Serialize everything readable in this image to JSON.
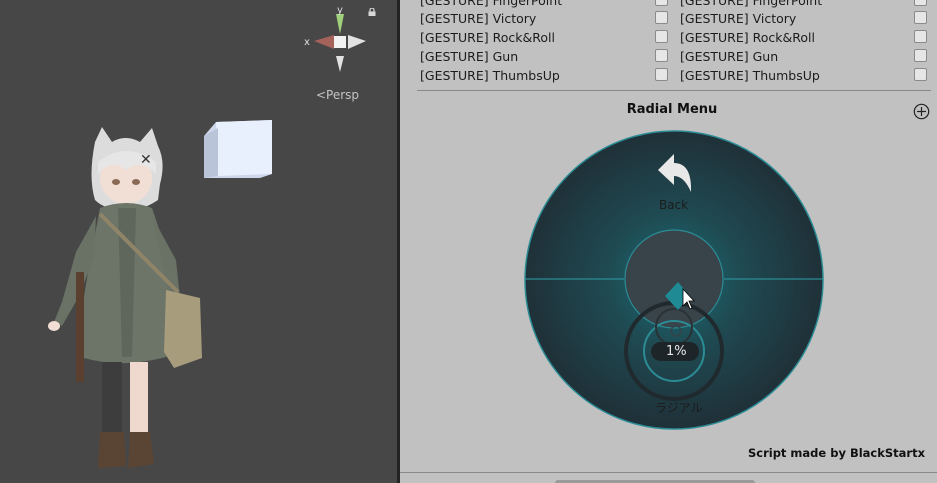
{
  "scene": {
    "persp_label": "<Persp",
    "gizmo": {
      "y_label": "y",
      "x_label": "x",
      "icons": [
        "lock-icon",
        "axis-gizmo-icon"
      ]
    }
  },
  "inspector": {
    "gesture_rows": [
      {
        "left": "[GESTURE] FingerPoint",
        "right": "[GESTURE] FingerPoint",
        "left_checked": false,
        "right_checked": false
      },
      {
        "left": "[GESTURE] Victory",
        "right": "[GESTURE] Victory",
        "left_checked": false,
        "right_checked": false
      },
      {
        "left": "[GESTURE] Rock&Roll",
        "right": "[GESTURE] Rock&Roll",
        "left_checked": false,
        "right_checked": false
      },
      {
        "left": "[GESTURE] Gun",
        "right": "[GESTURE] Gun",
        "left_checked": false,
        "right_checked": false
      },
      {
        "left": "[GESTURE] ThumbsUp",
        "right": "[GESTURE] ThumbsUp",
        "left_checked": false,
        "right_checked": false
      }
    ],
    "radial_menu": {
      "title": "Radial Menu",
      "back_label": "Back",
      "slot_label": "ラジアル",
      "percent": "1%",
      "percent_value": 0.01
    },
    "credit": "Script made by BlackStartx",
    "colors": {
      "panel_bg": "#c1c1c1",
      "radial_dark": "#1f3038",
      "radial_accent": "#1f8a93",
      "scene_bg": "#474747"
    }
  }
}
